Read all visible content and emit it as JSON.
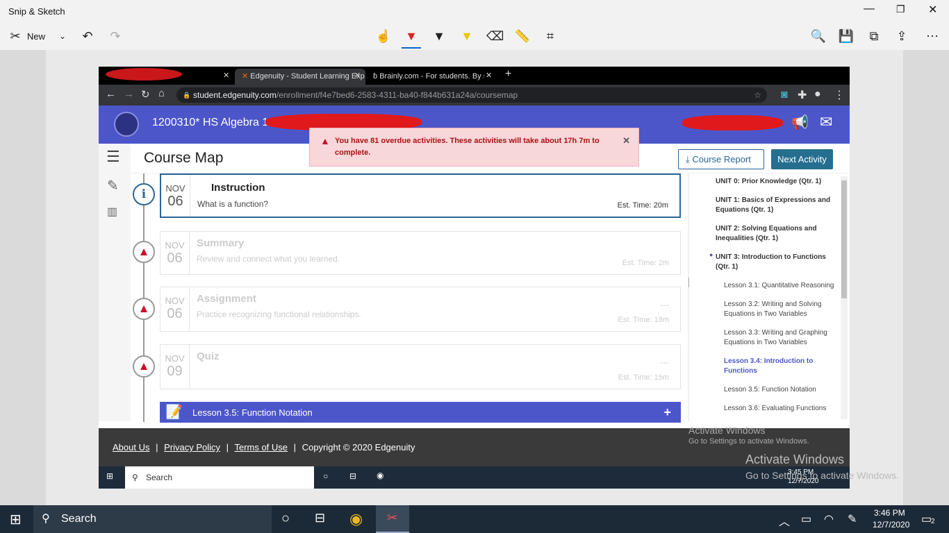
{
  "app": {
    "title": "Snip & Sketch",
    "new_label": "New"
  },
  "browser": {
    "tabs": [
      {
        "label": "Edgenuity - Student Learning Exp"
      },
      {
        "label": "Brainly.com - For students. By stu"
      }
    ],
    "url_host": "student.edgenuity.com",
    "url_path": "/enrollment/f4e7bed6-2583-4311-ba40-f844b631a24a/coursemap"
  },
  "course": {
    "title": "1200310* HS Algebra 1",
    "page_title": "Course Map",
    "course_report": "Course Report",
    "next_activity": "Next Activity"
  },
  "alert": {
    "text": "You have 81 overdue activities. These activities will take about 17h 7m to complete."
  },
  "activities": [
    {
      "month": "NOV",
      "day": "06",
      "title": "Instruction",
      "desc": "What is a function?",
      "est": "Est. Time: 20m",
      "dash": ""
    },
    {
      "month": "NOV",
      "day": "06",
      "title": "Summary",
      "desc": "Review and connect what you learned.",
      "est": "Est. Time: 2m",
      "dash": ""
    },
    {
      "month": "NOV",
      "day": "06",
      "title": "Assignment",
      "desc": "Practice recognizing functional relationships.",
      "est": "Est. Time: 18m",
      "dash": "---"
    },
    {
      "month": "NOV",
      "day": "09",
      "title": "Quiz",
      "desc": "",
      "est": "Est. Time: 15m",
      "dash": "---"
    }
  ],
  "next_lesson": {
    "label": "Lesson 3.5: Function Notation"
  },
  "toc": {
    "units": [
      "UNIT 0: Prior Knowledge (Qtr. 1)",
      "UNIT 1: Basics of Expressions and Equations (Qtr. 1)",
      "UNIT 2: Solving Equations and Inequalities (Qtr. 1)",
      "UNIT 3: Introduction to Functions (Qtr. 1)"
    ],
    "lessons": [
      "Lesson 3.1: Quantitative Reasoning",
      "Lesson 3.2: Writing and Solving Equations in Two Variables",
      "Lesson 3.3: Writing and Graphing Equations in Two Variables",
      "Lesson 3.4: Introduction to Functions",
      "Lesson 3.5: Function Notation",
      "Lesson 3.6: Evaluating Functions"
    ]
  },
  "footer": {
    "about": "About Us",
    "privacy": "Privacy Policy",
    "terms": "Terms of Use",
    "copyright": "Copyright © 2020 Edgenuity",
    "sep": "|"
  },
  "watermark": {
    "title": "Activate Windows",
    "sub": "Go to Settings to activate Windows."
  },
  "inner_taskbar": {
    "search": "Search",
    "time": "3:45 PM",
    "date": "12/7/2020"
  },
  "taskbar": {
    "search": "Search",
    "time": "3:46 PM",
    "date": "12/7/2020",
    "notifications": "2"
  },
  "colors": {
    "brand": "#4c56c9",
    "accent": "#2a6496",
    "alert": "#c8102e"
  }
}
